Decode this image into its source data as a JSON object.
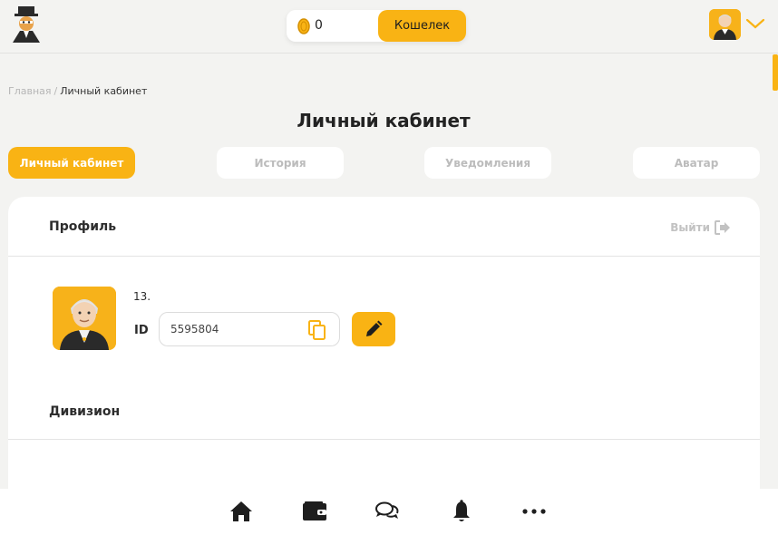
{
  "header": {
    "coin_balance": "0",
    "wallet_button": "Кошелек"
  },
  "breadcrumb": {
    "home": "Главная",
    "separator": "/",
    "current": "Личный кабинет"
  },
  "page": {
    "title": "Личный кабинет"
  },
  "tabs": [
    {
      "label": "Личный кабинет",
      "active": true
    },
    {
      "label": "История",
      "active": false
    },
    {
      "label": "Уведомления",
      "active": false
    },
    {
      "label": "Аватар",
      "active": false
    }
  ],
  "profile": {
    "section_title": "Профиль",
    "logout_label": "Выйти",
    "username": "13.",
    "id_label": "ID",
    "id_value": "5595804"
  },
  "division": {
    "section_title": "Дивизион"
  },
  "bottom_nav": {
    "icons": [
      "home-icon",
      "wallet-icon",
      "chat-icon",
      "bell-icon",
      "more-icon"
    ]
  },
  "colors": {
    "accent": "#f9b314",
    "background": "#f3f3f1",
    "card": "#ffffff",
    "muted_text": "#bcbcbc"
  }
}
